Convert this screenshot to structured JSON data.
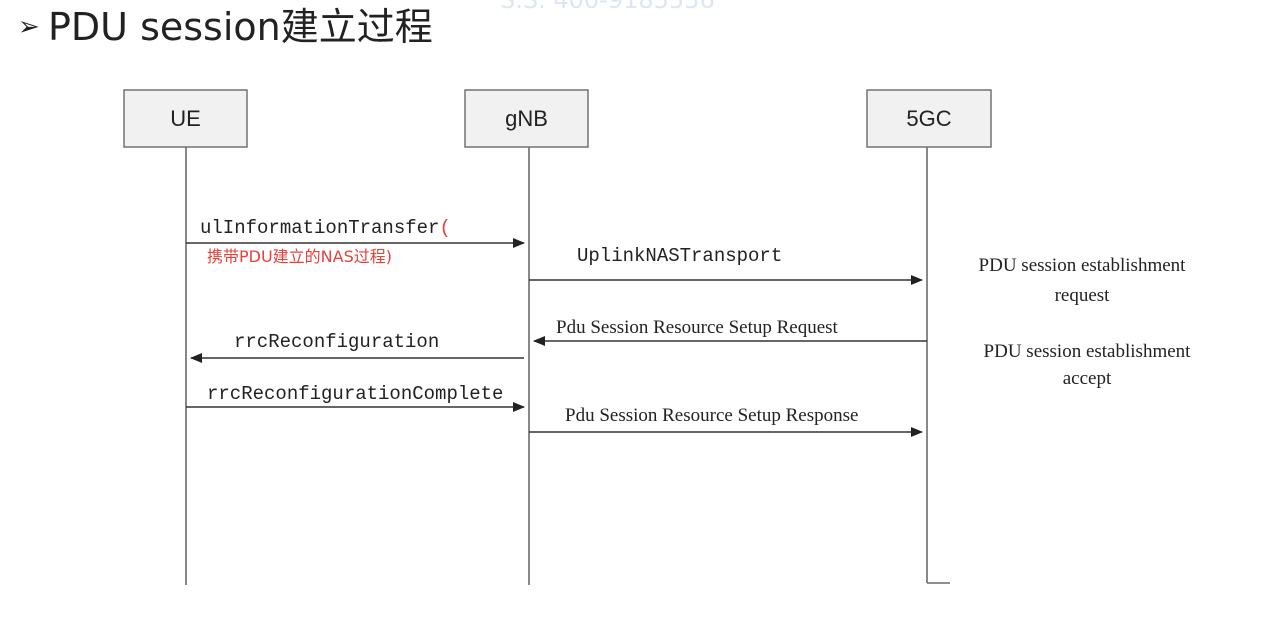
{
  "slide": {
    "bullet": "➢",
    "title": "PDU session建立过程",
    "faded_header": "S.S. 400-9185536"
  },
  "entities": {
    "ue": "UE",
    "gnb": "gNB",
    "core": "5GC"
  },
  "messages": {
    "ul_info_transfer": "ulInformationTransfer",
    "ul_info_paren": "(",
    "ul_info_note": "携带PDU建立的NAS过程)",
    "uplink_nas": "UplinkNASTransport",
    "setup_request": "Pdu Session Resource Setup Request",
    "rrc_reconfig": "rrcReconfiguration",
    "rrc_reconfig_complete": "rrcReconfigurationComplete",
    "setup_response": "Pdu Session Resource Setup Response"
  },
  "notes": {
    "est_request_line1": "PDU session establishment",
    "est_request_line2": "request",
    "est_accept_line1": "PDU session establishment",
    "est_accept_line2": "accept"
  },
  "colors": {
    "annotation_red": "#e8403a",
    "box_fill": "#f1f1f1",
    "line": "#333333"
  }
}
